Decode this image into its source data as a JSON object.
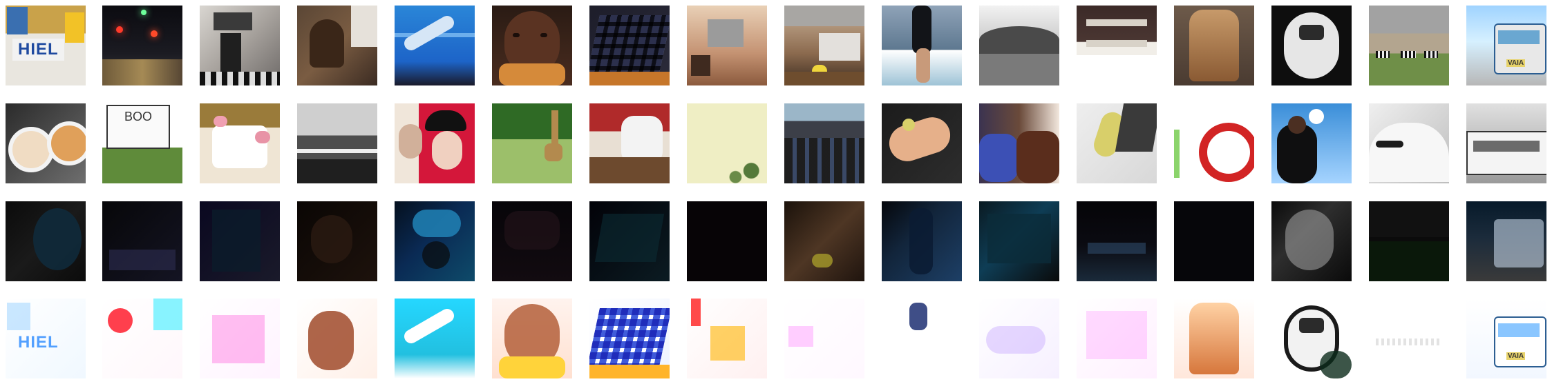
{
  "grid": {
    "rows": [
      {
        "label": "original",
        "tiles": [
          {
            "name": "shield-sign",
            "text": "HIEL"
          },
          {
            "name": "night-traffic-lights"
          },
          {
            "name": "kitchen-appliances"
          },
          {
            "name": "dog-on-couch"
          },
          {
            "name": "pool-person-arm"
          },
          {
            "name": "child-eating"
          },
          {
            "name": "calculator-keypad"
          },
          {
            "name": "kitchen-sink-room"
          },
          {
            "name": "kitchen-with-bananas"
          },
          {
            "name": "surfer-legs"
          },
          {
            "name": "stone-bridge-statues"
          },
          {
            "name": "bathroom-shelves"
          },
          {
            "name": "fire-hydrant"
          },
          {
            "name": "woman-with-camera"
          },
          {
            "name": "zebras-field"
          },
          {
            "name": "city-bus"
          }
        ]
      },
      {
        "label": "original",
        "tiles": [
          {
            "name": "coffee-and-pie"
          },
          {
            "name": "whiteboard-grass",
            "text": "BOO"
          },
          {
            "name": "wedding-cake"
          },
          {
            "name": "gray-road-trees"
          },
          {
            "name": "people-helmet"
          },
          {
            "name": "giraffes-field"
          },
          {
            "name": "people-at-table"
          },
          {
            "name": "pale-sky-branch"
          },
          {
            "name": "motorcycles-row"
          },
          {
            "name": "hand-holding-food"
          },
          {
            "name": "people-eating"
          },
          {
            "name": "phone-and-banana"
          },
          {
            "name": "red-ring-object"
          },
          {
            "name": "person-throwing-frisbee"
          },
          {
            "name": "white-train-closeup"
          },
          {
            "name": "train-side"
          }
        ]
      },
      {
        "label": "dark-variant",
        "tiles": [
          {
            "name": "dark-1"
          },
          {
            "name": "dark-2"
          },
          {
            "name": "dark-3"
          },
          {
            "name": "dark-4"
          },
          {
            "name": "dark-5"
          },
          {
            "name": "dark-6"
          },
          {
            "name": "dark-7"
          },
          {
            "name": "dark-8"
          },
          {
            "name": "dark-9"
          },
          {
            "name": "dark-10"
          },
          {
            "name": "dark-11"
          },
          {
            "name": "dark-12"
          },
          {
            "name": "dark-13"
          },
          {
            "name": "dark-14"
          },
          {
            "name": "dark-15"
          },
          {
            "name": "dark-16"
          }
        ]
      },
      {
        "label": "overexposed-variant",
        "tiles": [
          {
            "name": "bright-1",
            "text": "HIEL"
          },
          {
            "name": "bright-2"
          },
          {
            "name": "bright-3"
          },
          {
            "name": "bright-4"
          },
          {
            "name": "bright-5"
          },
          {
            "name": "bright-6"
          },
          {
            "name": "bright-7"
          },
          {
            "name": "bright-8"
          },
          {
            "name": "bright-9"
          },
          {
            "name": "bright-10"
          },
          {
            "name": "bright-11"
          },
          {
            "name": "bright-12"
          },
          {
            "name": "bright-13"
          },
          {
            "name": "bright-14"
          },
          {
            "name": "bright-15"
          },
          {
            "name": "bright-16"
          }
        ]
      }
    ]
  },
  "colors": {
    "background": "#ffffff",
    "bus_label": "#e7d26a"
  },
  "bus_text": "VAIA"
}
